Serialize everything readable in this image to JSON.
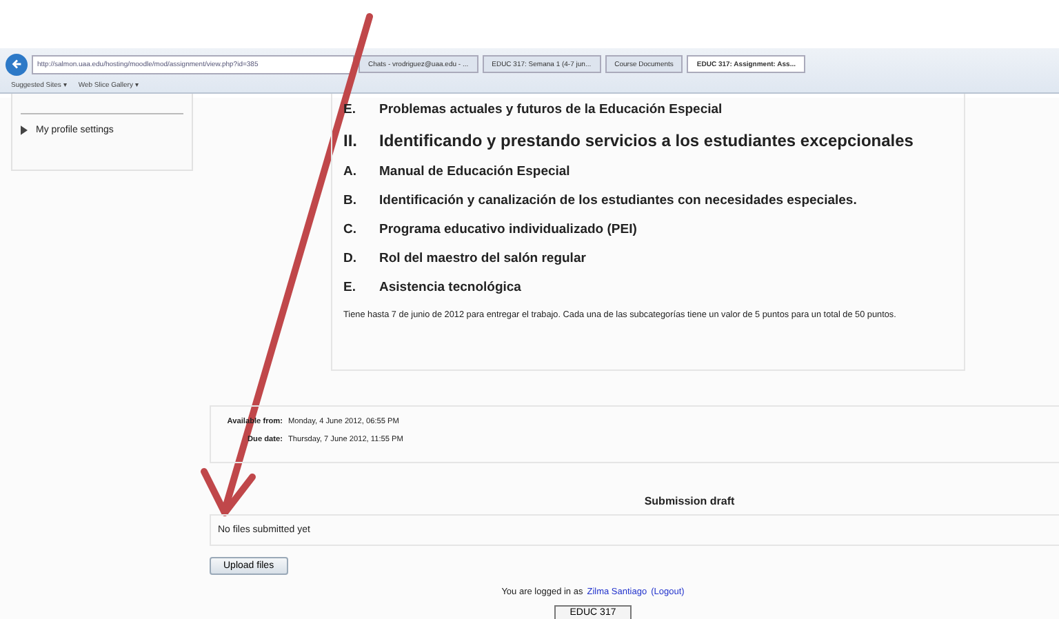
{
  "browser": {
    "url": "http://salmon.uaa.edu/hosting/moodle/mod/assignment/view.php?id=385",
    "tabs": [
      {
        "label": "Chats - vrodriguez@uaa.edu - ...",
        "selected": false
      },
      {
        "label": "EDUC 317: Semana 1 (4-7 jun...",
        "selected": false
      },
      {
        "label": "Course Documents",
        "selected": false
      },
      {
        "label": "EDUC 317: Assignment: Ass...",
        "selected": true
      }
    ],
    "favorites": [
      "Suggested Sites ▾",
      "Web Slice Gallery ▾"
    ]
  },
  "sidebar": {
    "items": [
      "My profile settings"
    ]
  },
  "assignment": {
    "outline": [
      {
        "kind": "item",
        "marker": "E.",
        "text": "Problemas actuales y futuros de la Educación Especial"
      },
      {
        "kind": "section",
        "marker": "II.",
        "text": "Identificando y prestando servicios a los estudiantes excepcionales"
      },
      {
        "kind": "item",
        "marker": "A.",
        "text": "Manual de Educación Especial"
      },
      {
        "kind": "item",
        "marker": "B.",
        "text": "Identificación y canalización de los estudiantes con necesidades  especiales."
      },
      {
        "kind": "item",
        "marker": "C.",
        "text": "Programa educativo individualizado (PEI)"
      },
      {
        "kind": "item",
        "marker": "D.",
        "text": "Rol del maestro del salón regular"
      },
      {
        "kind": "item",
        "marker": "E.",
        "text": "Asistencia tecnológica"
      }
    ],
    "note": "Tiene hasta 7 de junio de 2012 para entregar el trabajo. Cada una de las subcategorías tiene un valor de 5 puntos para un total de 50 puntos."
  },
  "dates": [
    {
      "label": "Available from:",
      "value": "Monday, 4 June 2012, 06:55 PM"
    },
    {
      "label": "Due date:",
      "value": "Thursday, 7 June 2012, 11:55 PM"
    }
  ],
  "submission": {
    "title": "Submission draft",
    "status": "No files submitted yet",
    "button": "Upload files"
  },
  "footer": {
    "prefix": "You are logged in as",
    "user": "Zilma Santiago",
    "logout": "(Logout)",
    "course_button": "EDUC 317"
  }
}
